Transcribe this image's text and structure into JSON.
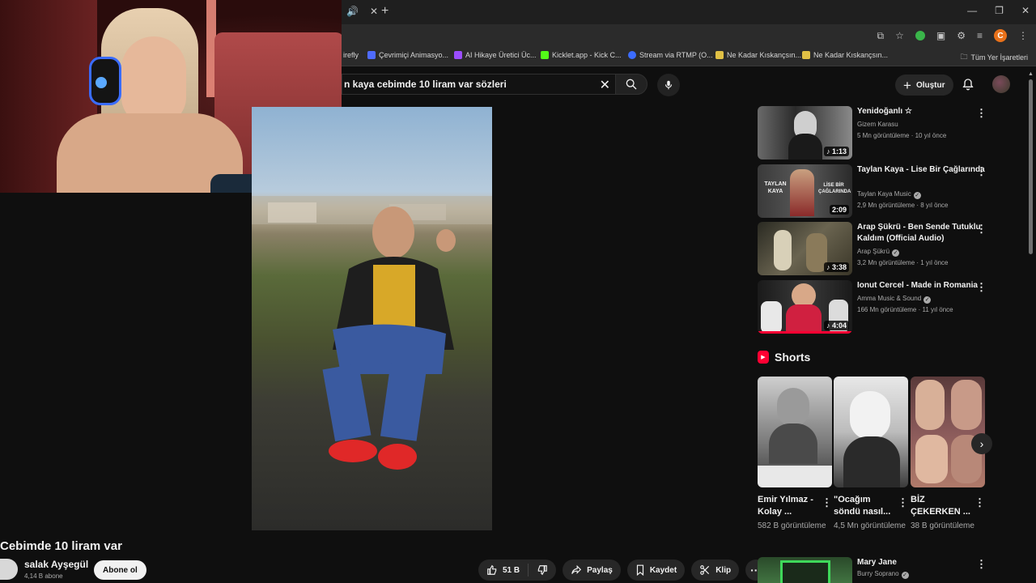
{
  "browser": {
    "bookmarks": [
      {
        "label": "irefly",
        "color": "#7a5cff"
      },
      {
        "label": "Çevrimiçi Animasyo...",
        "color": "#4f6bff"
      },
      {
        "label": "AI Hikaye Üretici Üc...",
        "color": "#9b4dff"
      },
      {
        "label": "Kicklet.app - Kick C...",
        "color": "#53fc18"
      },
      {
        "label": "Stream via RTMP (O...",
        "color": "#3c6cff"
      },
      {
        "label": "Ne Kadar Kıskançsın...",
        "color": "#e0c045"
      },
      {
        "label": "Ne Kadar Kıskançsın...",
        "color": "#e0c045"
      }
    ],
    "all_bookmarks": "Tüm Yer İşaretleri",
    "profile_letter": "C"
  },
  "header": {
    "search_value": "n kaya cebimde 10 liram var sözleri",
    "create_label": "Oluştur"
  },
  "video": {
    "title": "Cebimde 10 liram var",
    "channel": "salak Ayşegül",
    "subscribers": "4,14 B abone",
    "subscribe_label": "Abone ol",
    "likes": "51 B",
    "share_label": "Paylaş",
    "save_label": "Kaydet",
    "clip_label": "Klip"
  },
  "recommendations": [
    {
      "title": "Yenidoğanlı ☆",
      "channel": "Gizem Karasu",
      "verified": false,
      "meta": "5 Mn görüntüleme · 10 yıl önce",
      "duration": "1:13"
    },
    {
      "title": "Taylan Kaya - Lise Bir Çağlarında",
      "channel": "Taylan Kaya Music",
      "verified": true,
      "meta": "2,9 Mn görüntüleme · 8 yıl önce",
      "duration": "2:09"
    },
    {
      "title": "Arap Şükrü - Ben Sende Tutuklu Kaldım (Official Audio)",
      "channel": "Arap Şükrü",
      "verified": true,
      "meta": "3,2 Mn görüntüleme · 1 yıl önce",
      "duration": "3:38"
    },
    {
      "title": "Ionut Cercel - Made in Romania",
      "channel": "Amma Music & Sound",
      "verified": true,
      "meta": "166 Mn görüntüleme · 11 yıl önce",
      "duration": "4:04"
    },
    {
      "title": "Mary Jane",
      "channel": "Burry Soprano",
      "verified": true,
      "meta": "",
      "duration": ""
    }
  ],
  "shorts": {
    "heading": "Shorts",
    "items": [
      {
        "title": "Emir Yılmaz - Kolay ...",
        "views": "582 B görüntüleme"
      },
      {
        "title": "\"Ocağım söndü nasıl...",
        "views": "4,5 Mn görüntüleme"
      },
      {
        "title": "BİZ ÇEKERKEN ...",
        "views": "38 B görüntüleme"
      }
    ]
  },
  "thumb_overlays": {
    "taylan_left": "TAYLAN KAYA",
    "taylan_right": "LİSE BİR ÇAĞLARINDA"
  }
}
